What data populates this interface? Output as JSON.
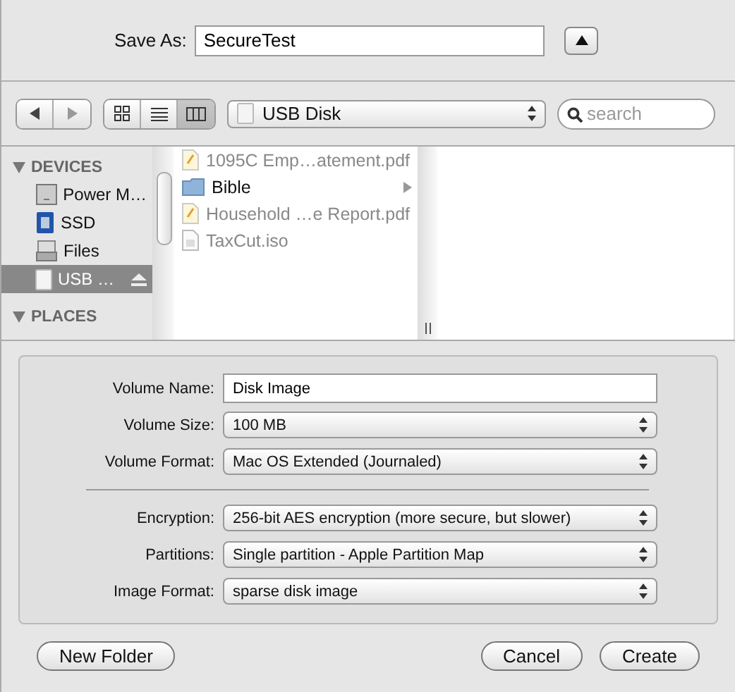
{
  "save_as": {
    "label": "Save As:",
    "value": "SecureTest",
    "expanded": true
  },
  "toolbar": {
    "views": [
      {
        "kind": "icons",
        "selected": false
      },
      {
        "kind": "list",
        "selected": false
      },
      {
        "kind": "columns",
        "selected": true
      }
    ],
    "location": "USB Disk",
    "search": {
      "placeholder": "search"
    }
  },
  "sidebar": {
    "sections": [
      {
        "title": "DEVICES",
        "items": [
          {
            "label": "Power M…",
            "kind": "computer",
            "selected": false
          },
          {
            "label": "SSD",
            "kind": "ssd",
            "selected": false
          },
          {
            "label": "Files",
            "kind": "drive",
            "selected": false
          },
          {
            "label": "USB …",
            "kind": "usb",
            "selected": true,
            "ejectable": true
          }
        ]
      },
      {
        "title": "PLACES"
      }
    ]
  },
  "files": [
    {
      "name": "1095C Emp…atement.pdf",
      "kind": "pdf",
      "disabled": true
    },
    {
      "name": "Bible",
      "kind": "folder",
      "disabled": false
    },
    {
      "name": "Household …e Report.pdf",
      "kind": "pdf",
      "disabled": true
    },
    {
      "name": "TaxCut.iso",
      "kind": "iso",
      "disabled": true
    }
  ],
  "options": [
    {
      "label": "Volume Name:",
      "kind": "text",
      "value": "Disk Image"
    },
    {
      "label": "Volume Size:",
      "kind": "popup",
      "value": "100 MB"
    },
    {
      "label": "Volume Format:",
      "kind": "popup",
      "value": "Mac OS Extended (Journaled)"
    },
    {
      "kind": "separator"
    },
    {
      "label": "Encryption:",
      "kind": "popup",
      "value": "256-bit AES encryption (more secure, but slower)"
    },
    {
      "label": "Partitions:",
      "kind": "popup",
      "value": "Single partition - Apple Partition Map"
    },
    {
      "label": "Image Format:",
      "kind": "popup",
      "value": "sparse disk image"
    }
  ],
  "buttons": {
    "left": [
      "New Folder"
    ],
    "right": [
      "Cancel",
      "Create"
    ]
  }
}
